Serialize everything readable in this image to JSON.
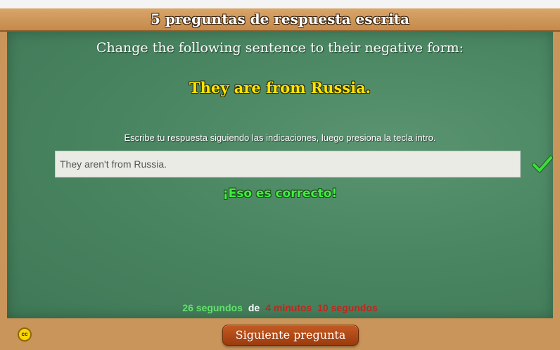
{
  "header": {
    "title": "5 preguntas de respuesta escrita"
  },
  "question": {
    "instruction": "Change the following sentence to their negative form:",
    "sentence": "They are from Russia.",
    "hint": "Escribe tu respuesta siguiendo las indicaciones, luego presiona la tecla intro."
  },
  "answer": {
    "value": "They aren't from Russia.",
    "status_icon": "check-icon",
    "feedback": "¡Eso es correcto!"
  },
  "timer": {
    "elapsed": "26 segundos",
    "separator": "de",
    "limit": "4 minutos  10 segundos"
  },
  "footer": {
    "license_icon": "creative-commons-icon",
    "license_text": "cc",
    "next_label": "Siguiente pregunta"
  },
  "colors": {
    "board": "#4a8662",
    "frame": "#c9955a",
    "sentence": "#ffe400",
    "feedback": "#3df23d",
    "elapsed": "#62e36a",
    "limit": "#c2261b",
    "next_button": "#b04a18"
  }
}
